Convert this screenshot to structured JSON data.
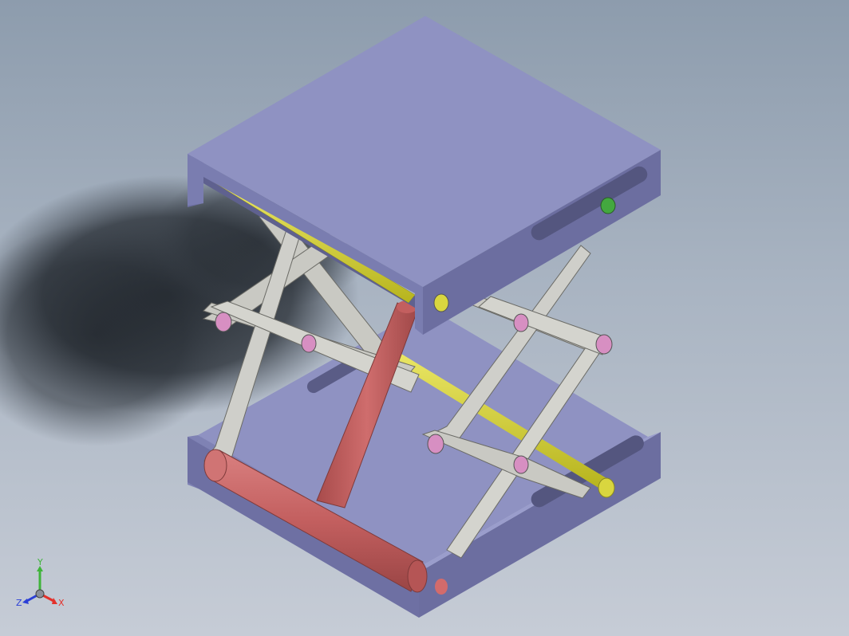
{
  "viewport": {
    "background_top": "#8d9cad",
    "background_bottom": "#c6ccd6"
  },
  "model": {
    "platform_color": "#8f92c2",
    "platform_side_color": "#6e70a3",
    "link_color": "#c9c9c3",
    "pin_color": "#d78fc2",
    "actuator_color": "#c35f5f",
    "shaft_color": "#d9d63f",
    "indicator_color": "#43a83f"
  },
  "triad": {
    "y_label": "Y",
    "z_label": "Z",
    "x_label": "X",
    "x_color": "#e3312b",
    "y_color": "#3fb43a",
    "z_color": "#2b3fd6"
  }
}
